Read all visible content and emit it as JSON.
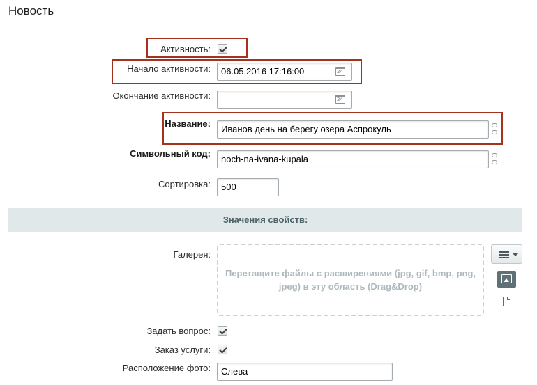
{
  "title": "Новость",
  "fields": {
    "active": {
      "label": "Активность:",
      "checked": true
    },
    "active_from": {
      "label": "Начало активности:",
      "value": "06.05.2016 17:16:00"
    },
    "active_to": {
      "label": "Окончание активности:",
      "value": ""
    },
    "name": {
      "label": "Название:",
      "value": "Иванов день на берегу озера Аспрокуль"
    },
    "code": {
      "label": "Символьный код:",
      "value": "noch-na-ivana-kupala"
    },
    "sort": {
      "label": "Сортировка:",
      "value": "500"
    }
  },
  "properties_section": {
    "title": "Значения свойств:"
  },
  "properties": {
    "gallery": {
      "label": "Галерея:",
      "dropzone_text": "Перетащите файлы с расширениями (jpg, gif, bmp, png, jpeg) в эту область (Drag&Drop)"
    },
    "ask_question": {
      "label": "Задать вопрос:",
      "checked": true
    },
    "order_service": {
      "label": "Заказ услуги:",
      "checked": true
    },
    "photo_position": {
      "label": "Расположение фото:",
      "value": "Слева"
    }
  },
  "icons": {
    "calendar": "calendar-icon",
    "link": "chain-link-icon",
    "menu": "hamburger-menu-icon",
    "image": "image-icon",
    "file": "file-icon"
  },
  "colors": {
    "highlight": "#a5311f",
    "section_bg": "#e1e8ea",
    "section_text": "#4b6267"
  }
}
